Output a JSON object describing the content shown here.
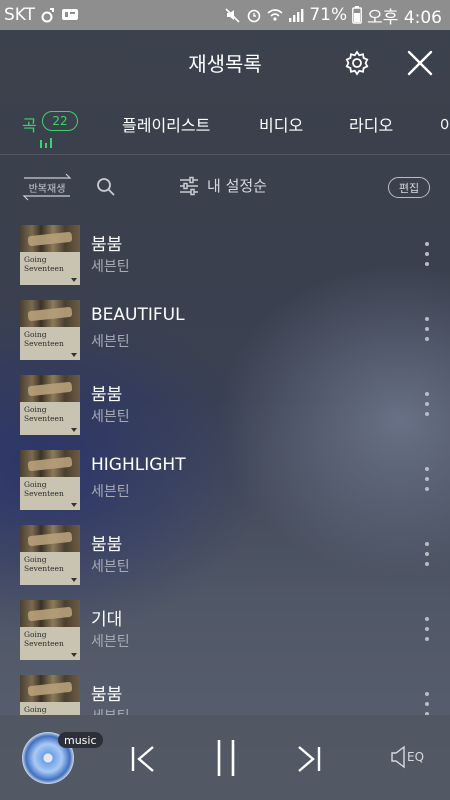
{
  "status_bar": {
    "carrier": "SKT",
    "battery": "71%",
    "time": "오후 4:06",
    "left_icons": [
      "music-app-icon",
      "talk-badge-icon"
    ],
    "right_icons": [
      "mute-icon",
      "alarm-icon",
      "wifi-icon",
      "signal-icon"
    ]
  },
  "header": {
    "title": "재생목록",
    "settings_icon": "gear-icon",
    "close_icon": "close-icon"
  },
  "tabs": [
    {
      "label": "곡",
      "count": "22",
      "active": true
    },
    {
      "label": "플레이리스트"
    },
    {
      "label": "비디오"
    },
    {
      "label": "라디오"
    },
    {
      "label": "아"
    }
  ],
  "toolbar": {
    "repeat_label": "반복재생",
    "sort_label": "내 설정순",
    "edit_label": "편집"
  },
  "album": {
    "line1": "Going",
    "line2": "Seventeen"
  },
  "songs": [
    {
      "title": "붐붐",
      "artist": "세븐틴"
    },
    {
      "title": "BEAUTIFUL",
      "artist": "세븐틴"
    },
    {
      "title": "붐붐",
      "artist": "세븐틴"
    },
    {
      "title": "HIGHLIGHT",
      "artist": "세븐틴"
    },
    {
      "title": "붐붐",
      "artist": "세븐틴"
    },
    {
      "title": "기대",
      "artist": "세븐틴"
    },
    {
      "title": "붐붐",
      "artist": "세븐틴"
    }
  ],
  "player": {
    "badge": "music",
    "eq_label": "EQ"
  },
  "colors": {
    "accent": "#3ed26d",
    "status_bar": "#8e8e8e",
    "secondary_text": "#a8abb3"
  }
}
